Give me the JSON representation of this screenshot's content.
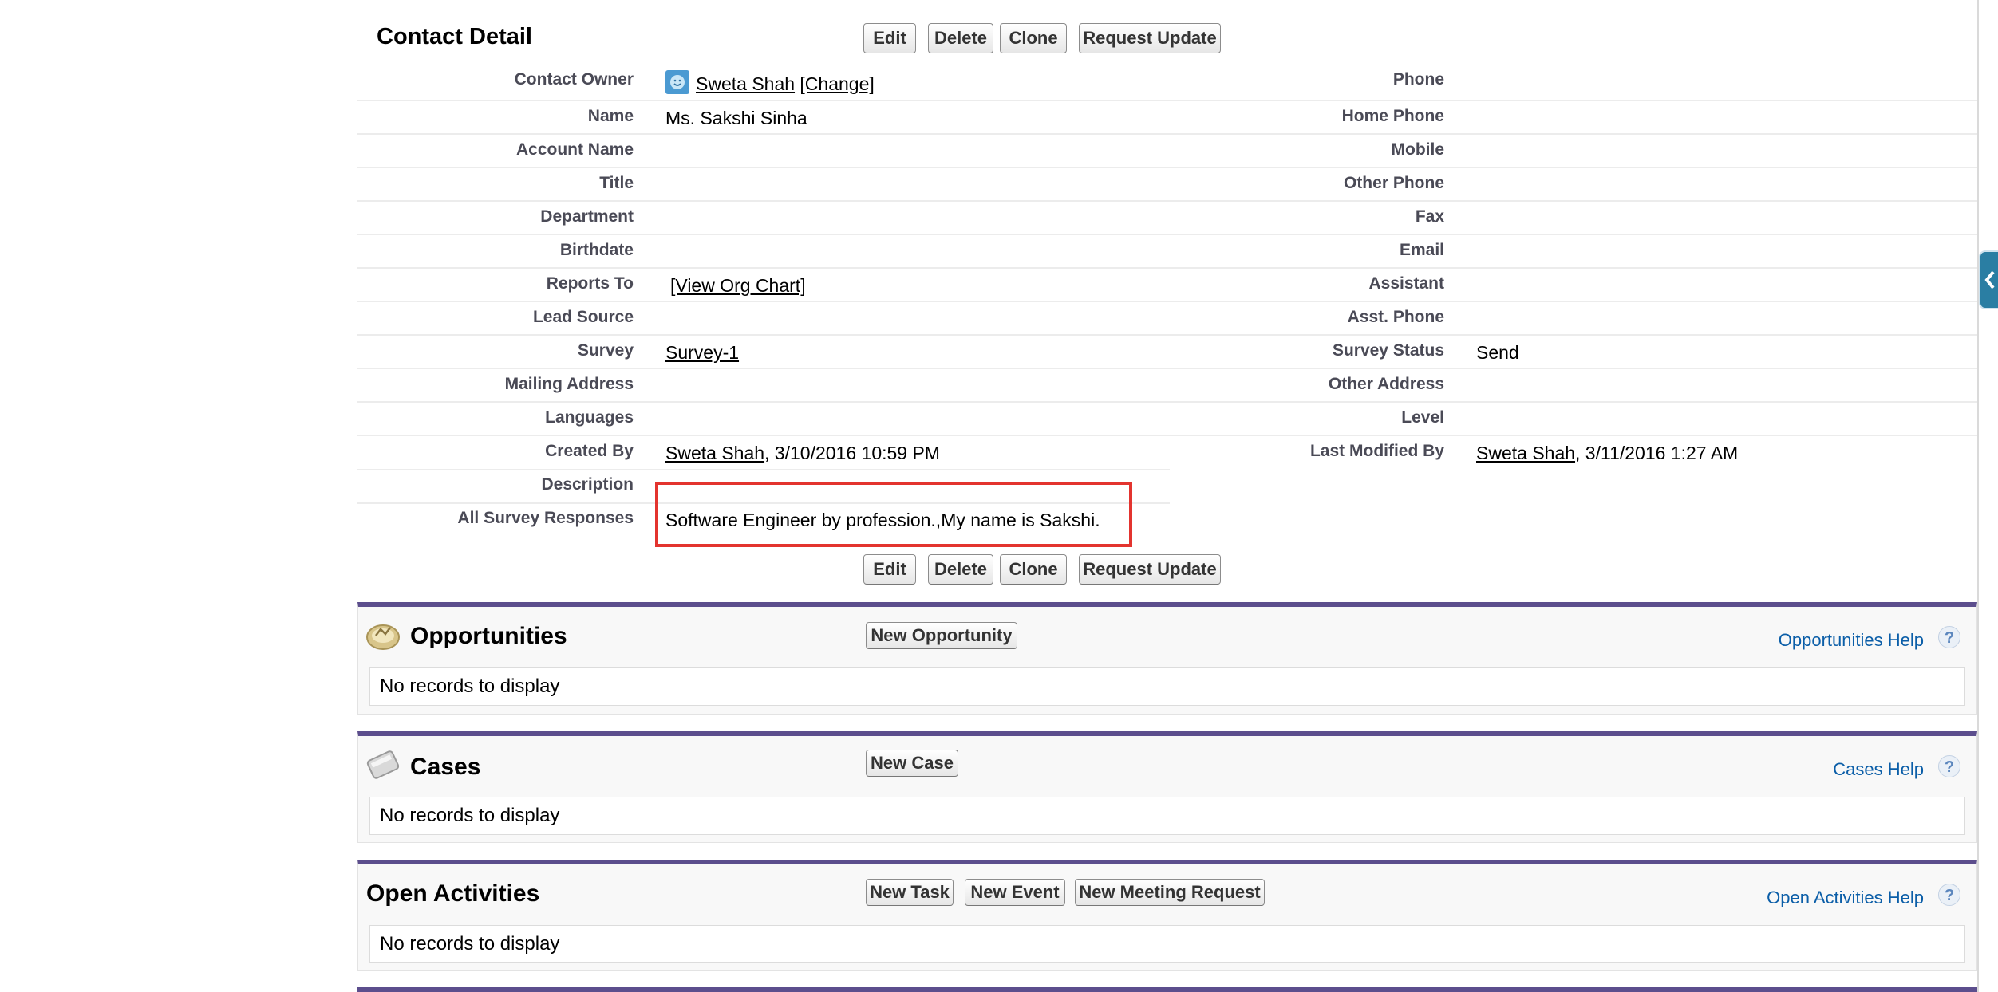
{
  "detail": {
    "title": "Contact Detail",
    "buttons": [
      "Edit",
      "Delete",
      "Clone",
      "Request Update"
    ],
    "left_fields": [
      {
        "label": "Contact Owner",
        "value": "",
        "link": "Sweta Shah",
        "suffix_link": "[Change]"
      },
      {
        "label": "Name",
        "value": "Ms. Sakshi Sinha"
      },
      {
        "label": "Account Name",
        "value": ""
      },
      {
        "label": "Title",
        "value": ""
      },
      {
        "label": "Department",
        "value": ""
      },
      {
        "label": "Birthdate",
        "value": ""
      },
      {
        "label": "Reports To",
        "value": "",
        "link": "[View Org Chart]"
      },
      {
        "label": "Lead Source",
        "value": ""
      },
      {
        "label": "Survey",
        "value": "",
        "link": "Survey-1"
      },
      {
        "label": "Mailing Address",
        "value": ""
      },
      {
        "label": "Languages",
        "value": ""
      },
      {
        "label": "Created By",
        "link": "Sweta Shah",
        "value": ", 3/10/2016 10:59 PM"
      },
      {
        "label": "Description",
        "value": ""
      },
      {
        "label": "All Survey Responses",
        "value": "Software Engineer by profession.,My name is Sakshi."
      }
    ],
    "right_fields": [
      {
        "label": "Phone",
        "value": ""
      },
      {
        "label": "Home Phone",
        "value": ""
      },
      {
        "label": "Mobile",
        "value": ""
      },
      {
        "label": "Other Phone",
        "value": ""
      },
      {
        "label": "Fax",
        "value": ""
      },
      {
        "label": "Email",
        "value": ""
      },
      {
        "label": "Assistant",
        "value": ""
      },
      {
        "label": "Asst. Phone",
        "value": ""
      },
      {
        "label": "Survey Status",
        "value": "Send"
      },
      {
        "label": "Other Address",
        "value": ""
      },
      {
        "label": "Level",
        "value": ""
      },
      {
        "label": "Last Modified By",
        "link": "Sweta Shah",
        "value": ", 3/11/2016 1:27 AM"
      }
    ],
    "highlight_color": "#e3342f"
  },
  "related_lists": [
    {
      "title": "Opportunities",
      "buttons": [
        "New Opportunity"
      ],
      "help": "Opportunities Help",
      "empty_text": "No records to display",
      "icon": "opportunity-icon"
    },
    {
      "title": "Cases",
      "buttons": [
        "New Case"
      ],
      "help": "Cases Help",
      "empty_text": "No records to display",
      "icon": "case-icon"
    },
    {
      "title": "Open Activities",
      "buttons": [
        "New Task",
        "New Event",
        "New Meeting Request"
      ],
      "help": "Open Activities Help",
      "empty_text": "No records to display"
    }
  ],
  "help_glyph": "?",
  "accent_color": "#5c4e8d"
}
